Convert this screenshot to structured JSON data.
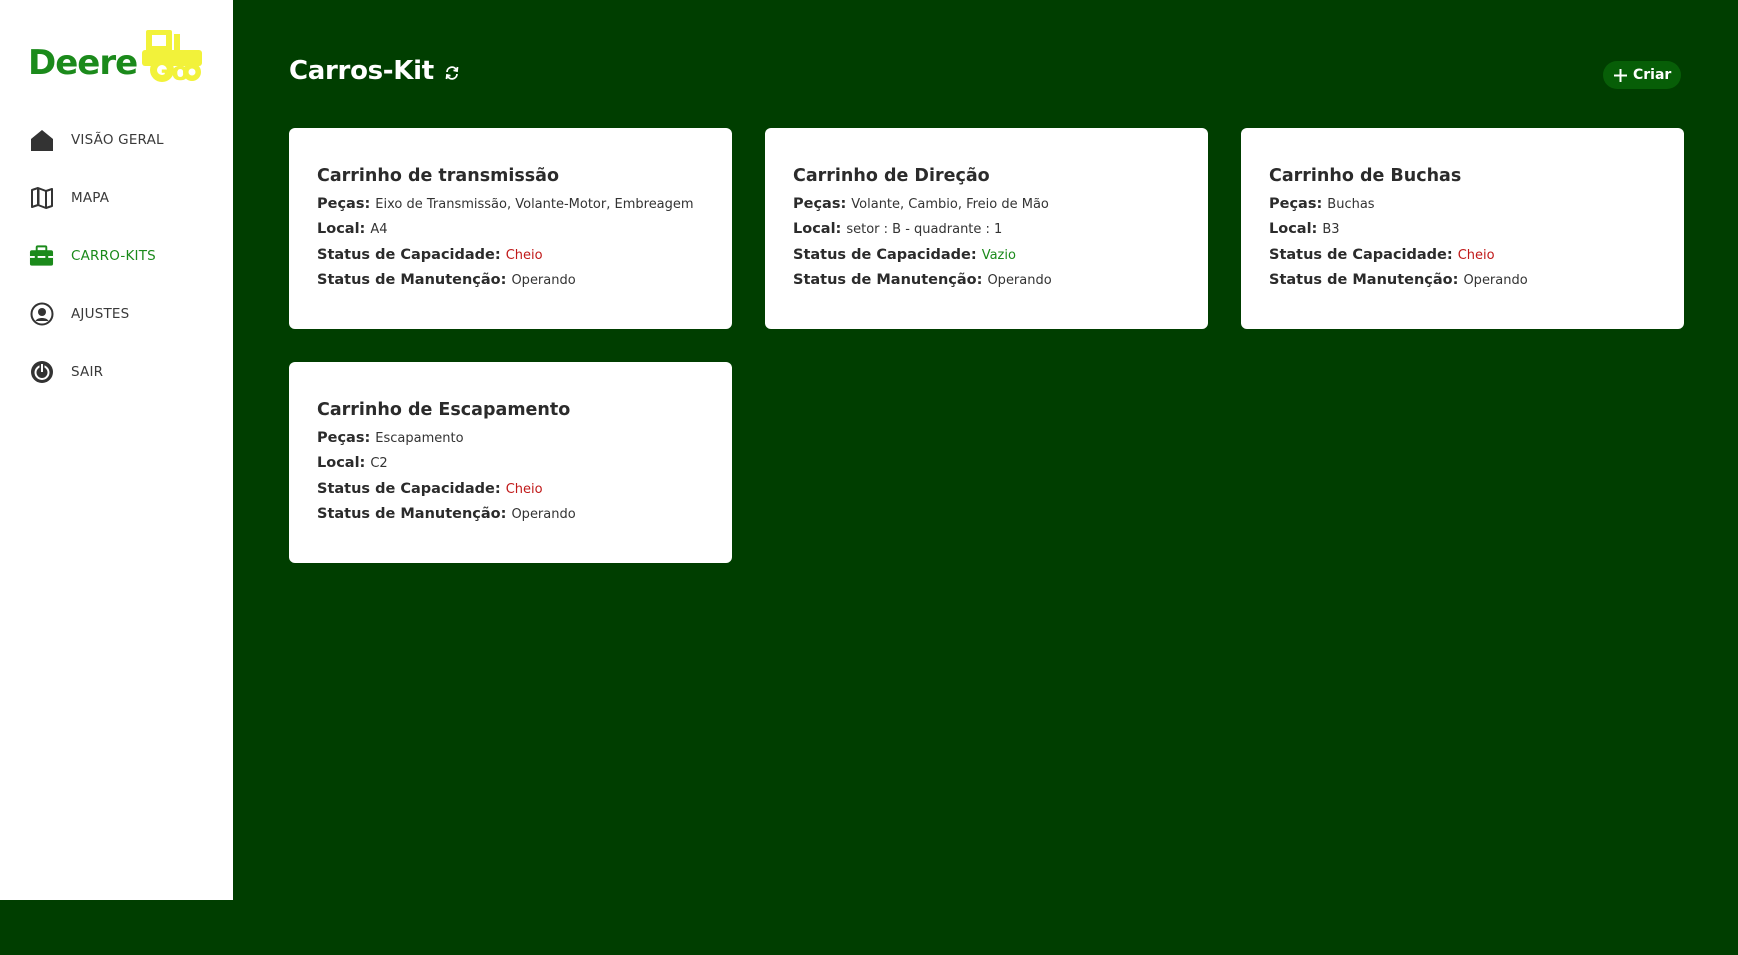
{
  "app": {
    "logo_text": "Deere",
    "logo_icon": "tractor-icon",
    "brand_green": "#1b8a1b",
    "brand_yellow": "#f2f23a",
    "background": "#003e00"
  },
  "sidebar": {
    "items": [
      {
        "label": "VISÃO GERAL",
        "icon": "home-icon",
        "active": false
      },
      {
        "label": "MAPA",
        "icon": "map-icon",
        "active": false
      },
      {
        "label": "CARRO-KITS",
        "icon": "toolbox-icon",
        "active": true
      },
      {
        "label": "AJUSTES",
        "icon": "user-circle-icon",
        "active": false
      },
      {
        "label": "SAIR",
        "icon": "power-icon",
        "active": false
      }
    ]
  },
  "header": {
    "title": "Carros-Kit",
    "refresh_icon": "refresh-icon",
    "create_label": "Criar",
    "create_icon": "plus-icon"
  },
  "labels": {
    "pecas": "Peças:",
    "local": "Local:",
    "capacidade": "Status de Capacidade:",
    "manutencao": "Status de Manutenção:"
  },
  "status_colors": {
    "Cheio": "#c01818",
    "Vazio": "#1b8a1b"
  },
  "cards": [
    {
      "title": "Carrinho de transmissão",
      "pecas": "Eixo de Transmissão, Volante-Motor, Embreagem",
      "local": "A4",
      "capacidade": "Cheio",
      "manutencao": "Operando"
    },
    {
      "title": "Carrinho de Direção",
      "pecas": "Volante, Cambio, Freio de Mão",
      "local": "setor : B - quadrante : 1",
      "capacidade": "Vazio",
      "manutencao": "Operando"
    },
    {
      "title": "Carrinho de Buchas",
      "pecas": "Buchas",
      "local": "B3",
      "capacidade": "Cheio",
      "manutencao": "Operando"
    },
    {
      "title": "Carrinho de Escapamento",
      "pecas": "Escapamento",
      "local": "C2",
      "capacidade": "Cheio",
      "manutencao": "Operando"
    }
  ]
}
